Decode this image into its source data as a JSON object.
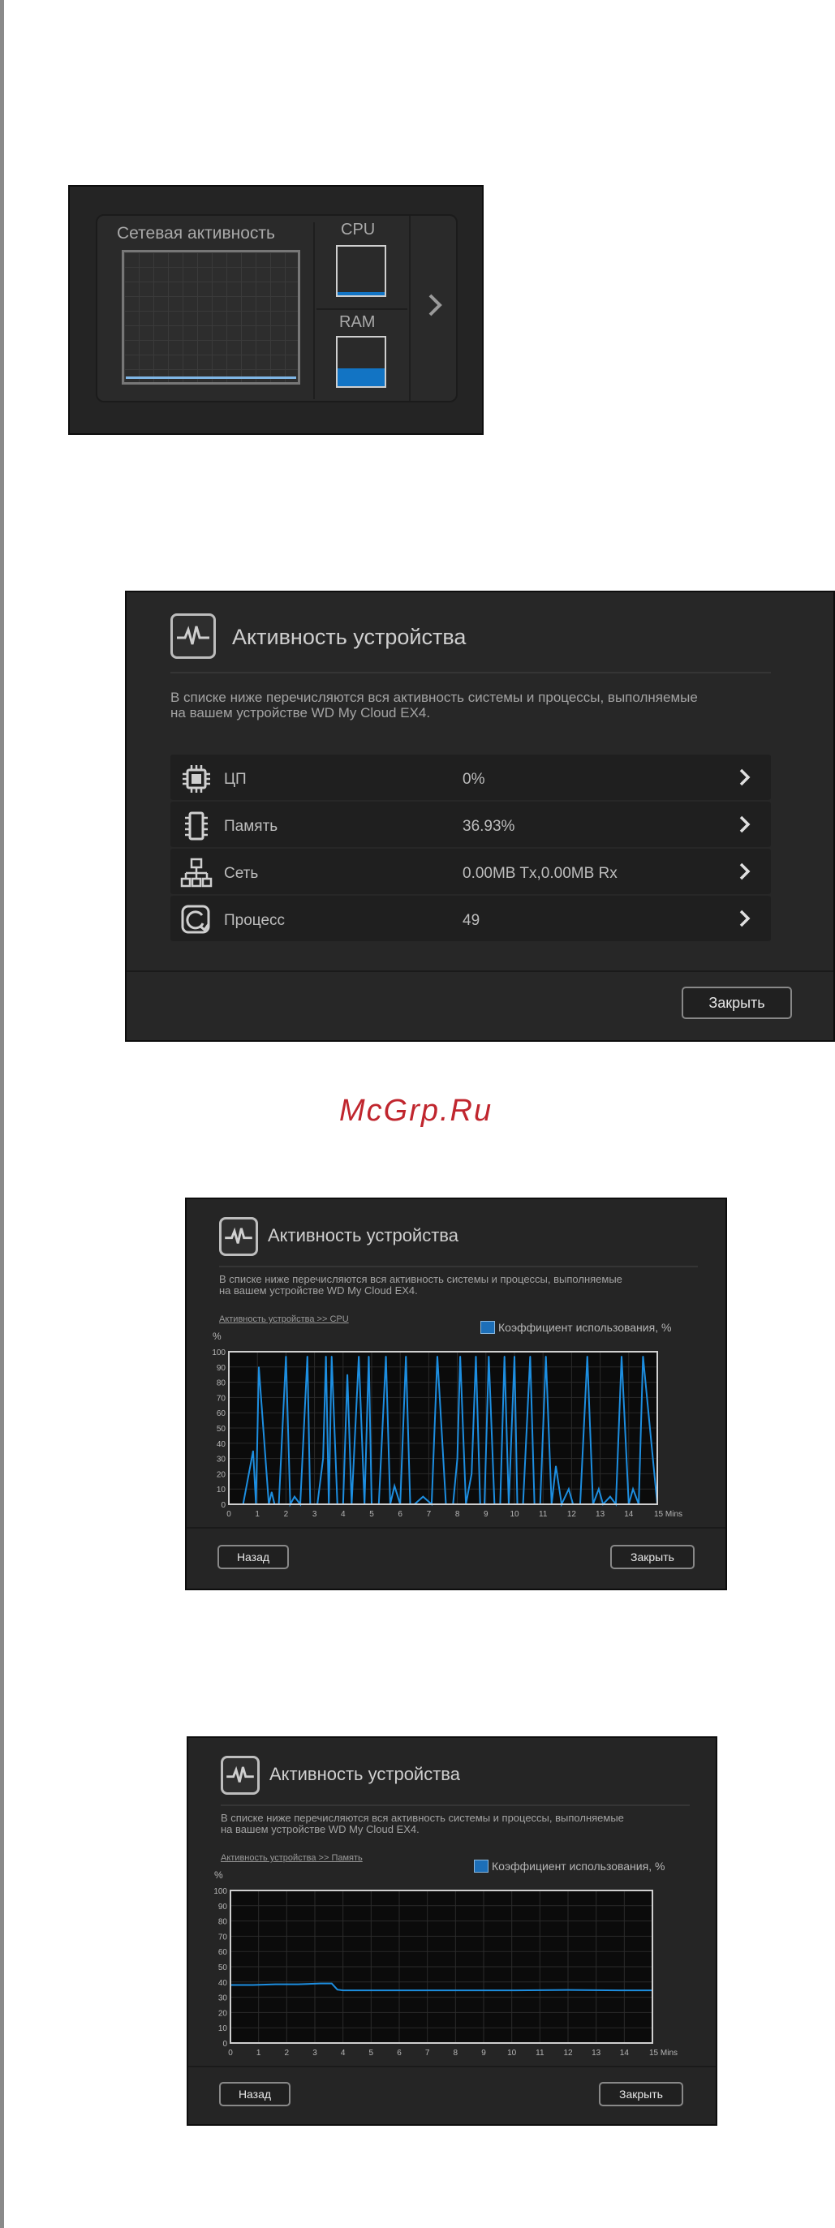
{
  "widget": {
    "network_title": "Сетевая активность",
    "cpu_label": "CPU",
    "ram_label": "RAM",
    "cpu_level_percent": 6,
    "ram_level_percent": 37
  },
  "activity_dialog": {
    "title": "Активность устройства",
    "description_line1": "В списке ниже перечисляются вся активность системы и процессы, выполняемые",
    "description_line2": "на вашем устройстве WD My Cloud EX4.",
    "rows": [
      {
        "icon": "cpu-chip-icon",
        "label": "ЦП",
        "value": "0%"
      },
      {
        "icon": "memory-module-icon",
        "label": "Память",
        "value": "36.93%"
      },
      {
        "icon": "network-icon",
        "label": "Сеть",
        "value": "0.00MB Tx,0.00MB Rx"
      },
      {
        "icon": "process-icon",
        "label": "Процесс",
        "value": "49"
      }
    ],
    "close_label": "Закрыть"
  },
  "watermark": "McGrp.Ru",
  "cpu_chart_dialog": {
    "title": "Активность устройства",
    "description_line1": "В списке ниже перечисляются вся активность системы и процессы, выполняемые",
    "description_line2": "на вашем устройстве WD My Cloud EX4.",
    "breadcrumb": "Активность устройства >> CPU",
    "back_label": "Назад",
    "close_label": "Закрыть"
  },
  "memory_chart_dialog": {
    "title": "Активность устройства",
    "description_line1": "В списке ниже перечисляются вся активность системы и процессы, выполняемые",
    "description_line2": "на вашем устройстве WD My Cloud EX4.",
    "breadcrumb": "Активность устройства >> Память",
    "back_label": "Назад",
    "close_label": "Закрыть"
  },
  "colors": {
    "accent": "#1274c4",
    "line": "#1d8ee0",
    "panel": "#272727"
  },
  "chart_data": [
    {
      "type": "line",
      "title": "",
      "xlabel": "",
      "ylabel": "%",
      "x_unit": "Mins",
      "x_ticks": [
        "0",
        "1",
        "2",
        "3",
        "4",
        "5",
        "6",
        "7",
        "8",
        "9",
        "10",
        "11",
        "12",
        "13",
        "14",
        "15 Mins"
      ],
      "y_ticks": [
        "100",
        "90",
        "80",
        "70",
        "60",
        "50",
        "40",
        "30",
        "20",
        "10",
        "0"
      ],
      "ylim": [
        0,
        100
      ],
      "xlim": [
        0,
        15
      ],
      "grid": true,
      "legend_position": "top-right",
      "series": [
        {
          "name": "Коэффициент использования, %",
          "x": [
            0,
            0.5,
            0.85,
            0.95,
            1.05,
            1.4,
            1.5,
            1.6,
            1.75,
            2.0,
            2.15,
            2.3,
            2.5,
            2.75,
            2.85,
            2.95,
            3.1,
            3.3,
            3.4,
            3.5,
            3.6,
            3.8,
            4.0,
            4.15,
            4.3,
            4.55,
            4.75,
            4.9,
            5.0,
            5.25,
            5.5,
            5.65,
            5.8,
            6.0,
            6.2,
            6.35,
            6.5,
            6.8,
            7.1,
            7.3,
            7.6,
            7.85,
            8.0,
            8.1,
            8.3,
            8.5,
            8.65,
            8.8,
            8.95,
            9.1,
            9.3,
            9.5,
            9.65,
            9.8,
            10.0,
            10.1,
            10.3,
            10.55,
            10.7,
            10.9,
            11.1,
            11.3,
            11.45,
            11.65,
            11.9,
            12.05,
            12.3,
            12.55,
            12.75,
            12.95,
            13.1,
            13.35,
            13.55,
            13.75,
            14.0,
            14.15,
            14.35,
            14.5,
            15
          ],
          "y": [
            0,
            0,
            35,
            0,
            90,
            0,
            8,
            0,
            0,
            97,
            0,
            5,
            0,
            97,
            0,
            0,
            0,
            30,
            97,
            0,
            97,
            0,
            0,
            85,
            0,
            97,
            0,
            97,
            0,
            0,
            97,
            0,
            12,
            0,
            97,
            0,
            0,
            5,
            0,
            97,
            0,
            0,
            30,
            97,
            0,
            20,
            97,
            0,
            0,
            97,
            0,
            0,
            97,
            0,
            97,
            0,
            0,
            97,
            0,
            0,
            97,
            0,
            25,
            0,
            10,
            0,
            0,
            97,
            0,
            10,
            0,
            5,
            0,
            97,
            0,
            10,
            0,
            97,
            0
          ]
        }
      ]
    },
    {
      "type": "line",
      "title": "",
      "xlabel": "",
      "ylabel": "%",
      "x_unit": "Mins",
      "x_ticks": [
        "0",
        "1",
        "2",
        "3",
        "4",
        "5",
        "6",
        "7",
        "8",
        "9",
        "10",
        "11",
        "12",
        "13",
        "14",
        "15 Mins"
      ],
      "y_ticks": [
        "100",
        "90",
        "80",
        "70",
        "60",
        "50",
        "40",
        "30",
        "20",
        "10",
        "0"
      ],
      "ylim": [
        0,
        100
      ],
      "xlim": [
        0,
        15
      ],
      "grid": true,
      "legend_position": "top-right",
      "series": [
        {
          "name": "Коэффициент использования, %",
          "x": [
            0,
            0.8,
            1.6,
            2.4,
            3.2,
            3.6,
            3.8,
            4.0,
            6.0,
            8.0,
            10.0,
            12.0,
            14.0,
            15
          ],
          "y": [
            38,
            38,
            38.5,
            38.5,
            39,
            39,
            35,
            34.5,
            34.5,
            34.5,
            34.5,
            34.8,
            34.5,
            34.5
          ]
        }
      ]
    }
  ]
}
